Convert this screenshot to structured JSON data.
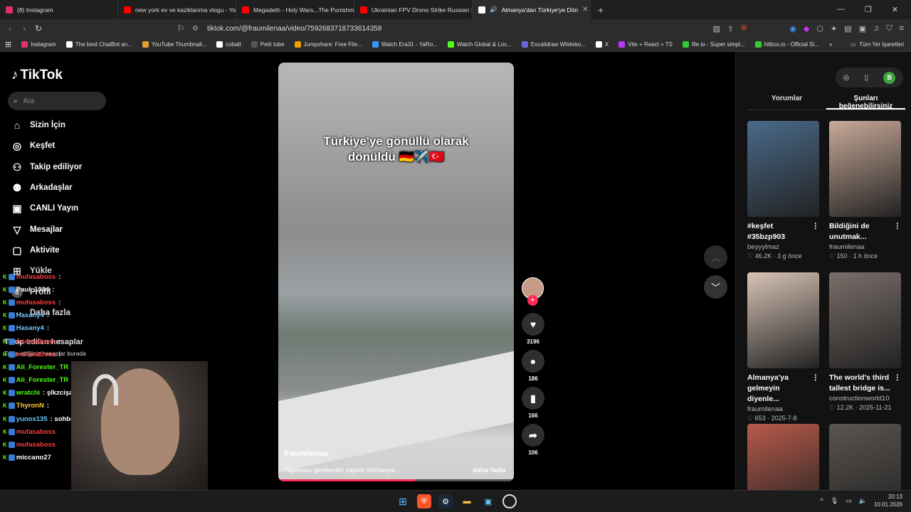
{
  "tabs": [
    {
      "title": "(8) Instagram",
      "color": "#e1306c"
    },
    {
      "title": "new york ev ve kaziklanma vlogu - Yo",
      "color": "#ff0000"
    },
    {
      "title": "Megadeth - Holy Wars...The Punishm",
      "color": "#ff0000"
    },
    {
      "title": "Ukrainian FPV Drone Strike Russian S",
      "color": "#ff0000"
    },
    {
      "title": "Almanya'dan Türkiye'ye Dön",
      "color": "#ffffff"
    }
  ],
  "address": {
    "url": "tiktok.com/@fraumilenaa/video/7592683718733614358"
  },
  "bookmarks": [
    {
      "label": "Instagram",
      "color": "#e1306c"
    },
    {
      "label": "The best ChatBot an...",
      "color": "#ffffff"
    },
    {
      "label": "YouTube Thumbnail...",
      "color": "#e0a030"
    },
    {
      "label": "cobalt",
      "color": "#ffffff"
    },
    {
      "label": "Petit tube",
      "color": "#222222"
    },
    {
      "label": "Jumpshare: Free File...",
      "color": "#f0a000"
    },
    {
      "label": "Watch Era31 - YaRo...",
      "color": "#3399ff"
    },
    {
      "label": "Watch Global & Loc...",
      "color": "#53fc18"
    },
    {
      "label": "Excalidraw Whitebo...",
      "color": "#6965db"
    },
    {
      "label": "X",
      "color": "#ffffff"
    },
    {
      "label": "Vite + React + TS",
      "color": "#bd34fe"
    },
    {
      "label": "file.io - Super simpl...",
      "color": "#33cc33"
    },
    {
      "label": "hitbox.io - Official Si...",
      "color": "#33cc33"
    }
  ],
  "bookmark_folder": "Tüm Yer İşaretleri",
  "sidebar": {
    "logo": "TikTok",
    "search_placeholder": "Ara",
    "nav": [
      "Sizin İçin",
      "Keşfet",
      "Takip ediliyor",
      "Arkadaşlar",
      "CANLI Yayın",
      "Mesajlar",
      "Aktivite",
      "Yükle",
      "Profil",
      "Daha fazla"
    ],
    "following_title": "Takip edilen hesaplar",
    "following_sub": "Takip ettiğiniz hesaplar burada"
  },
  "chat": [
    {
      "user": "mufasaboss",
      "msg": ":",
      "color": "#ff3d3d"
    },
    {
      "user": "Paul_1984",
      "msg": ":",
      "color": "#ffffff"
    },
    {
      "user": "mufasaboss",
      "msg": ":",
      "color": "#ff3d3d"
    },
    {
      "user": "Hasany4",
      "msg": ":",
      "color": "#6ec6ff"
    },
    {
      "user": "Hasany4",
      "msg": ":",
      "color": "#6ec6ff"
    },
    {
      "user": "mufasaboss",
      "msg": ":",
      "color": "#ff3d3d"
    },
    {
      "user": "mufasaboss",
      "msg": ":",
      "color": "#ff3d3d"
    },
    {
      "user": "Ali_Forester_TR",
      "msg": ":",
      "color": "#53fc18"
    },
    {
      "user": "Ali_Forester_TR",
      "msg": ":",
      "color": "#53fc18"
    },
    {
      "user": "wratchi",
      "msg": ": şlkzcişaklşca",
      "color": "#53fc18"
    },
    {
      "user": "ThyronN",
      "msg": ":",
      "color": "#ffcc33"
    },
    {
      "user": "yunox135",
      "msg": ": sohbet",
      "color": "#6ec6ff"
    },
    {
      "user": "mufasaboss",
      "msg": "",
      "color": "#ff3d3d"
    },
    {
      "user": "mufasaboss",
      "msg": "",
      "color": "#ff3d3d"
    },
    {
      "user": "miccano27",
      "msg": "",
      "color": "#ffffff"
    }
  ],
  "video": {
    "overlay_line1": "Türkiye'ye gönüllü olarak",
    "overlay_line2": "dönüldü 🇩🇪✈️🇹🇷",
    "author": "fraumilenaa",
    "age": "· 2 g önce",
    "caption": "Yapılması gerekenler yapıldı #almanya...",
    "more": "daha fazla",
    "progress": 0.58
  },
  "actions": {
    "likes": "3196",
    "comments": "186",
    "saves": "166",
    "shares": "106"
  },
  "right": {
    "tab_comments": "Yorumlar",
    "tab_suggested": "Şunları beğenebilirsiniz",
    "avatar_letter": "B",
    "cards": [
      {
        "title1": "#keşfet",
        "title2": "#35bzp903",
        "user": "beyyylmaz",
        "meta": "♡ 46.2K · 3 g önce",
        "thumb": "#4a6a8a"
      },
      {
        "title1": "Bildiğini de",
        "title2": "unutmak...",
        "user": "fraumilenaa",
        "meta": "♡ 150 · 1 h önce",
        "thumb": "#c9aa99"
      },
      {
        "title1": "Almanya'ya",
        "title2": "gelmeyin diyenle...",
        "user": "fraumilenaa",
        "meta": "♡ 653 · 2025-7-8",
        "thumb": "#d8c4b6"
      },
      {
        "title1": "The world's third",
        "title2": "tallest bridge is...",
        "user": "constructionworld10",
        "meta": "♡ 12.2K · 2025-11-21",
        "thumb": "#7a6f6a"
      },
      {
        "title1": "",
        "title2": "",
        "user": "",
        "meta": "",
        "thumb": "#b85a4a"
      },
      {
        "title1": "",
        "title2": "",
        "user": "",
        "meta": "",
        "thumb": "#5a5550"
      }
    ]
  },
  "taskbar": {
    "time": "20:13",
    "date": "10.01.2026"
  }
}
